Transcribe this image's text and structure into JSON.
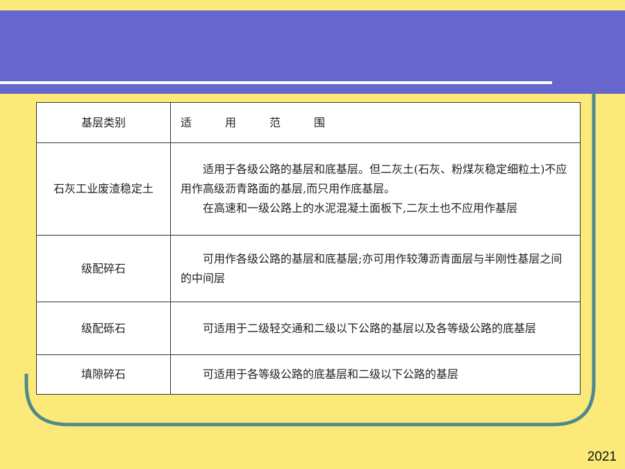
{
  "header": {
    "col1": "基层类别",
    "col2_chars": [
      "适",
      "用",
      "范",
      "围"
    ]
  },
  "rows": [
    {
      "category": "石灰工业废渣稳定土",
      "paragraphs": [
        "适用于各级公路的基层和底基层。但二灰土(石灰、粉煤灰稳定细粒土)不应用作高级沥青路面的基层,而只用作底基层。",
        "在高速和一级公路上的水泥混凝土面板下,二灰土也不应用作基层"
      ]
    },
    {
      "category": "级配碎石",
      "paragraphs": [
        "可用作各级公路的基层和底基层;亦可用作较薄沥青面层与半刚性基层之间的中间层"
      ]
    },
    {
      "category": "级配砾石",
      "paragraphs": [
        "可适用于二级轻交通和二级以下公路的基层以及各等级公路的底基层"
      ]
    },
    {
      "category": "填隙碎石",
      "paragraphs": [
        "可适用于各等级公路的底基层和二级以下公路的基层"
      ]
    }
  ],
  "footer": {
    "year": "2021"
  },
  "colors": {
    "background": "#fbe97a",
    "title_bar": "#6666cc",
    "frame": "#4f8a8b"
  }
}
